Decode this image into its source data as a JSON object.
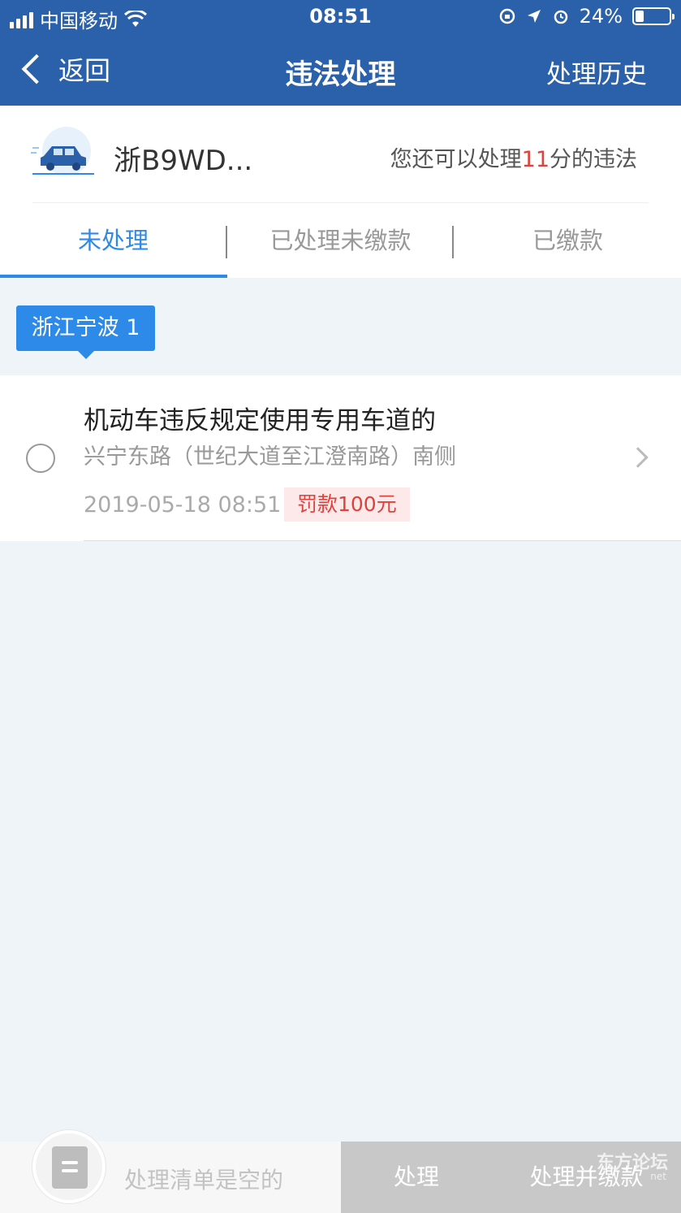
{
  "status_bar": {
    "carrier": "中国移动",
    "time": "08:51",
    "battery": "24%",
    "battery_level": 0.24
  },
  "nav": {
    "back_label": "返回",
    "title": "违法处理",
    "history_label": "处理历史"
  },
  "car": {
    "plate": "浙B9WD...",
    "quota_prefix": "您还可以处理",
    "quota_points": "11",
    "quota_suffix": "分的违法"
  },
  "tabs": [
    {
      "label": "未处理",
      "active": true
    },
    {
      "label": "已处理未缴款",
      "active": false
    },
    {
      "label": "已缴款",
      "active": false
    }
  ],
  "region": {
    "label": "浙江宁波 1"
  },
  "violations": [
    {
      "title": "机动车违反规定使用专用车道的",
      "location": "兴宁东路（世纪大道至江澄南路）南侧",
      "time": "2019-05-18 08:51",
      "fine": "罚款100元"
    }
  ],
  "bottom": {
    "cart_text": "处理清单是空的",
    "process_label": "处理",
    "process_pay_label": "处理并缴款",
    "watermark": "东方论坛",
    "watermark_sub": "net"
  },
  "colors": {
    "nav_blue": "#2b61ab",
    "accent_blue": "#2d8ae8",
    "red": "#e0413a"
  }
}
